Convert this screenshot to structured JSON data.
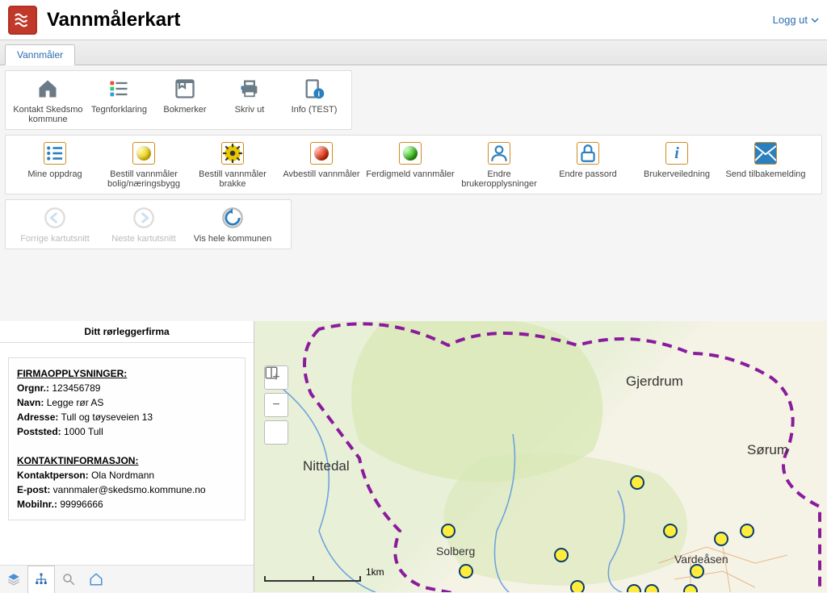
{
  "header": {
    "title": "Vannmålerkart",
    "logout": "Logg ut"
  },
  "tab": {
    "label": "Vannmåler"
  },
  "group1": {
    "btn1": "Kontakt Skedsmo kommune",
    "btn2": "Tegnforklaring",
    "btn3": "Bokmerker",
    "btn4": "Skriv ut",
    "btn5": "Info (TEST)"
  },
  "group2": {
    "b1": "Mine oppdrag",
    "b2": "Bestill vannmåler bolig/næringsbygg",
    "b3": "Bestill vannmåler brakke",
    "b4": "Avbestill vannmåler",
    "b5": "Ferdigmeld vannmåler",
    "b6": "Endre brukeropplysninger",
    "b7": "Endre passord",
    "b8": "Brukerveiledning",
    "b9": "Send tilbakemelding"
  },
  "group3": {
    "prev": "Forrige kartutsnitt",
    "next": "Neste kartutsnitt",
    "whole": "Vis hele kommunen"
  },
  "sidebar": {
    "title": "Ditt rørleggerfirma",
    "company_heading": "FIRMAOPPLYSNINGER:",
    "orgnr_label": "Orgnr.:",
    "orgnr": "123456789",
    "navn_label": "Navn:",
    "navn": "Legge rør AS",
    "adresse_label": "Adresse:",
    "adresse": "Tull og tøyseveien 13",
    "poststed_label": "Poststed:",
    "poststed": "1000 Tull",
    "contact_heading": "KONTAKTINFORMASJON:",
    "kontakt_label": "Kontaktperson:",
    "kontakt": "Ola Nordmann",
    "epost_label": "E-post:",
    "epost": "vannmaler@skedsmo.kommune.no",
    "mobil_label": "Mobilnr.:",
    "mobil": "99996666"
  },
  "map": {
    "scale": "1km",
    "places": {
      "gjerdrum": "Gjerdrum",
      "sorum": "Sørum",
      "nittedal": "Nittedal",
      "solberg": "Solberg",
      "vardeasen": "Vardeåsen"
    }
  }
}
